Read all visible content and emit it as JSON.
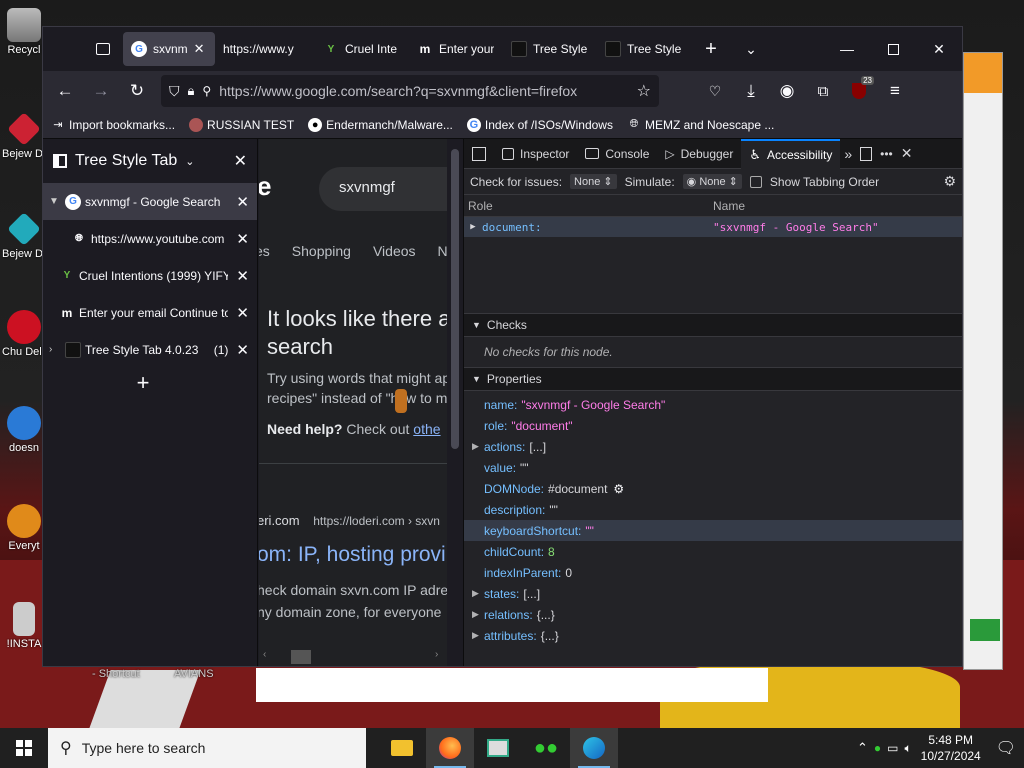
{
  "desktop": {
    "icons": [
      {
        "label": "Recycl",
        "icon": "recycle-bin-icon"
      },
      {
        "label": "Bejew Delu",
        "icon": "bejeweled-icon"
      },
      {
        "label": "Bejew Delu",
        "icon": "bejeweled-icon"
      },
      {
        "label": "Chu Delu",
        "icon": "chuzzle-icon"
      },
      {
        "label": "doesn",
        "icon": "app-icon"
      },
      {
        "label": "Everyt",
        "icon": "everything-icon"
      },
      {
        "label": "!INSTA",
        "icon": "installer-icon"
      }
    ],
    "behind_labels": [
      "- Shortcut",
      "AVIANS"
    ]
  },
  "browser": {
    "tabs": [
      {
        "title": "sxvnm",
        "favicon": "google-icon",
        "active": true
      },
      {
        "title": "https://www.y",
        "favicon": "none",
        "active": false
      },
      {
        "title": "Cruel Inte",
        "favicon": "yify-icon",
        "active": false
      },
      {
        "title": "Enter your",
        "favicon": "m-icon",
        "active": false
      },
      {
        "title": "Tree Style",
        "favicon": "tree-style-tab-icon",
        "active": false
      },
      {
        "title": "Tree Style",
        "favicon": "tree-style-tab-icon",
        "active": false
      }
    ],
    "url": "https://www.google.com/search?q=sxvnmgf&client=firefox",
    "extension_badge": "23",
    "bookmarks": [
      {
        "label": "Import bookmarks...",
        "icon": "import-icon"
      },
      {
        "label": "RUSSIAN TEST",
        "icon": "russian-test-icon"
      },
      {
        "label": "Endermanch/Malware...",
        "icon": "github-icon"
      },
      {
        "label": "Index of /ISOs/Windows",
        "icon": "google-icon"
      },
      {
        "label": "MEMZ and Noescape ...",
        "icon": "globe-icon"
      }
    ]
  },
  "sidebar": {
    "title": "Tree Style Tab",
    "tabs": [
      {
        "title": "sxvnmgf - Google Search",
        "favicon": "google-icon",
        "twisty": "▼",
        "selected": true,
        "count": ""
      },
      {
        "title": "https://www.youtube.com",
        "favicon": "globe-icon",
        "twisty": "",
        "selected": false,
        "count": ""
      },
      {
        "title": "Cruel Intentions (1999) YIFY -",
        "favicon": "yify-icon",
        "twisty": "",
        "selected": false,
        "count": ""
      },
      {
        "title": "Enter your email Continue to",
        "favicon": "m-icon",
        "twisty": "",
        "selected": false,
        "count": ""
      },
      {
        "title": "Tree Style Tab 4.0.23",
        "favicon": "tree-style-tab-icon",
        "twisty": "›",
        "selected": false,
        "count": "(1)"
      }
    ]
  },
  "google": {
    "logo_tail": "e",
    "query": "sxvnmgf",
    "nav": [
      "es",
      "Shopping",
      "Videos",
      "N"
    ],
    "heading": "It looks like there a",
    "heading2": "search",
    "try_text": "Try using words that might ap",
    "try_text2": "recipes\" instead of \"how to m",
    "need_help": "Need help?",
    "check_out": "Check out",
    "link": "othe",
    "result_site": "eri.com",
    "result_url": "https://loderi.com › sxvn",
    "result_title": "om: IP, hosting provi",
    "result_snip1": "heck domain sxvn.com IP adres",
    "result_snip2": "ny domain zone, for everyone"
  },
  "devtools": {
    "tabs": [
      "Inspector",
      "Console",
      "Debugger",
      "Accessibility"
    ],
    "active_tab": "Accessibility",
    "check_label": "Check for issues:",
    "check_value": "None",
    "simulate_label": "Simulate:",
    "simulate_value": "None",
    "tabbing_label": "Show Tabbing Order",
    "col_role": "Role",
    "col_name": "Name",
    "tree": {
      "role": "document:",
      "name": "\"sxvnmgf - Google Search\""
    },
    "checks_title": "Checks",
    "checks_empty": "No checks for this node.",
    "properties_title": "Properties",
    "properties": [
      {
        "key": "name:",
        "value": "\"sxvnmgf - Google Search\"",
        "kind": "string",
        "expandable": false
      },
      {
        "key": "role:",
        "value": "\"document\"",
        "kind": "string",
        "expandable": false
      },
      {
        "key": "actions:",
        "value": "[...]",
        "kind": "plain",
        "expandable": true
      },
      {
        "key": "value:",
        "value": "\"\"",
        "kind": "plain",
        "expandable": false
      },
      {
        "key": "DOMNode:",
        "value": "#document",
        "kind": "plain",
        "expandable": false
      },
      {
        "key": "description:",
        "value": "\"\"",
        "kind": "plain",
        "expandable": false
      },
      {
        "key": "keyboardShortcut:",
        "value": "\"\"",
        "kind": "string",
        "expandable": false
      },
      {
        "key": "childCount:",
        "value": "8",
        "kind": "number",
        "expandable": false
      },
      {
        "key": "indexInParent:",
        "value": "0",
        "kind": "plain",
        "expandable": false
      },
      {
        "key": "states:",
        "value": "[...]",
        "kind": "plain",
        "expandable": true
      },
      {
        "key": "relations:",
        "value": "{...}",
        "kind": "plain",
        "expandable": true
      },
      {
        "key": "attributes:",
        "value": "{...}",
        "kind": "plain",
        "expandable": true
      }
    ]
  },
  "taskbar": {
    "search_placeholder": "Type here to search",
    "time": "5:48 PM",
    "date": "10/27/2024"
  }
}
